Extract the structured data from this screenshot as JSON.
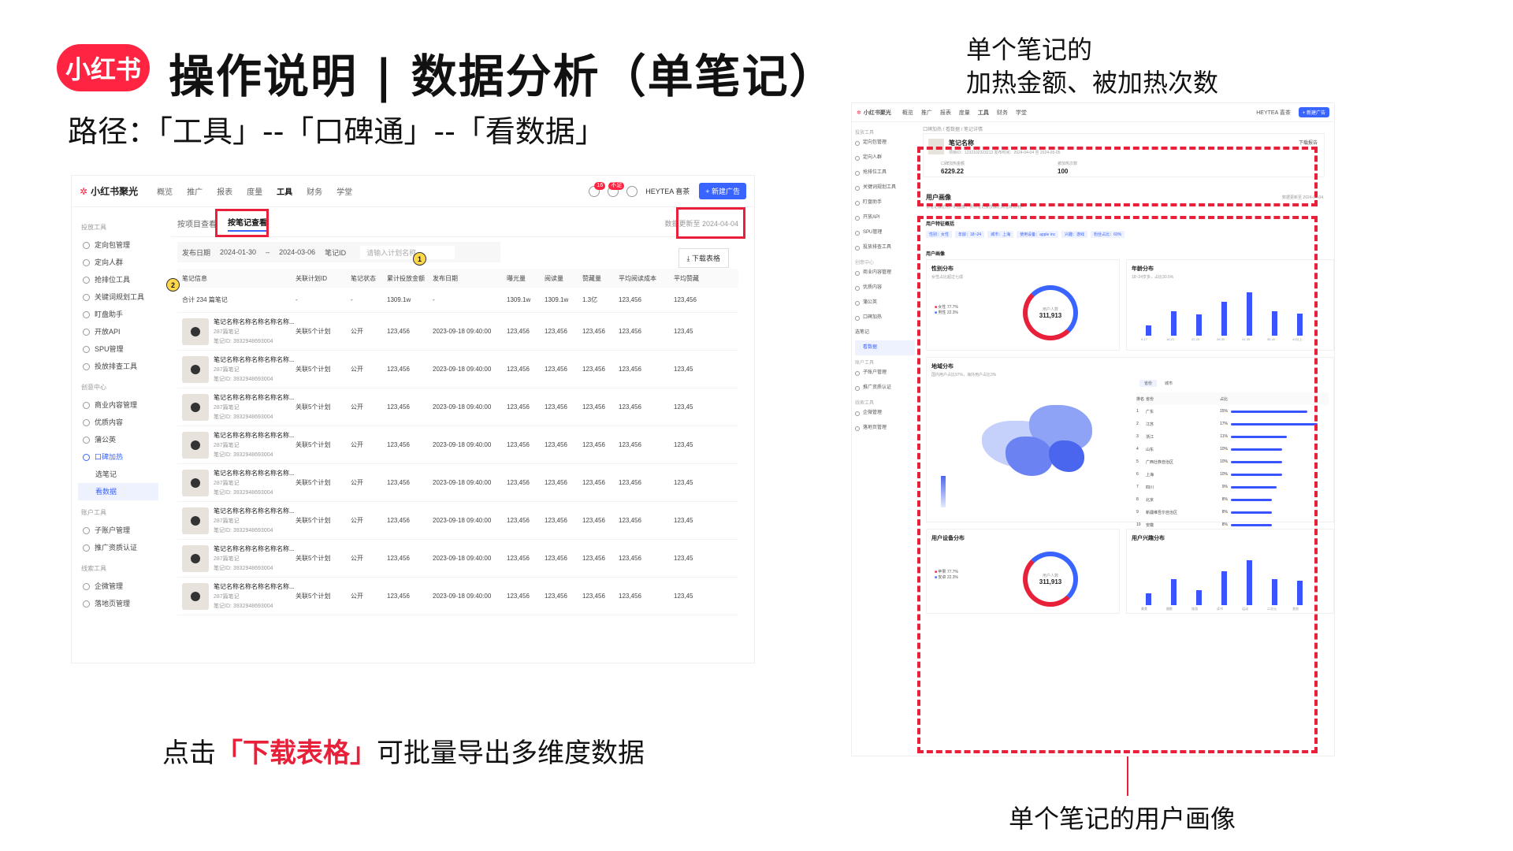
{
  "header": {
    "logo_text": "小红书",
    "title": "操作说明 | 数据分析（单笔记）",
    "path": "路径：「工具」--「口碑通」--「看数据」"
  },
  "caption": {
    "prefix": "点击",
    "highlight": "「下载表格」",
    "suffix": "可批量导出多维度数据"
  },
  "annotations": {
    "top_right_line1": "单个笔记的",
    "top_right_line2": "加热金额、被加热次数",
    "bottom_right": "单个笔记的用户画像"
  },
  "left_shot": {
    "app_name": "小红书聚光",
    "nav": [
      "概览",
      "推广",
      "报表",
      "度量",
      "工具",
      "财务",
      "学堂"
    ],
    "badges": [
      "16",
      "不足"
    ],
    "account": "HEYTEA 喜茶",
    "new_ad_button": "+ 新建广告",
    "sidebar": {
      "group1": "投放工具",
      "items1": [
        "定向包管理",
        "定向人群",
        "抢排位工具",
        "关键词规划工具",
        "盯盘助手",
        "开放API",
        "SPU管理",
        "投放排查工具"
      ],
      "group2": "创意中心",
      "items2": [
        "商业内容管理",
        "优质内容",
        "蒲公英",
        "口碑加热"
      ],
      "sub_items": [
        "选笔记",
        "看数据"
      ],
      "group3": "账户工具",
      "items3": [
        "子账户管理",
        "推广资质认证"
      ],
      "group4": "线索工具",
      "items4": [
        "企微管理",
        "落地页管理"
      ]
    },
    "tabs": [
      "按项目查看",
      "按笔记查看"
    ],
    "update_text": "数据更新至 2024-04-04",
    "filters": {
      "date_label": "发布日期",
      "date_from": "2024-01-30",
      "date_to": "2024-03-06",
      "select": "笔记ID",
      "search_placeholder": "请输入计划名称"
    },
    "download_button": "下载表格",
    "markers": [
      "1",
      "2"
    ],
    "columns": [
      "笔记信息",
      "关联计划ID",
      "笔记状态",
      "累计投放金额",
      "发布日期",
      "曝光量",
      "阅读量",
      "赞藏量",
      "平均阅读成本",
      "平均赞藏"
    ],
    "total_row": [
      "合计 234 篇笔记",
      "-",
      "-",
      "1309.1w",
      "-",
      "1309.1w",
      "1309.1w",
      "1.3亿",
      "123,456",
      "123,456"
    ],
    "row_template": {
      "title": "笔记名称名称名称名称名称...",
      "sub1": "287篇笔记",
      "sub2": "笔记ID: 3932948693004",
      "plan": "关联5个计划",
      "status": "公开",
      "amount": "123,456",
      "date": "2023-09-18 09:40:00",
      "expo": "123,456",
      "read": "123,456",
      "like": "123,456",
      "avg": "123,456",
      "avg2": "123,45"
    }
  },
  "right_shot": {
    "app_name": "小红书聚光",
    "breadcrumb": "口碑加热 / 看数据 / 笔记详情",
    "note_name": "笔记名称",
    "note_meta": "项目ID：1232102323213   发布时间：2024-04-04 至 2024-05-05",
    "download": "下载报告",
    "metric1_label": "口碑加热金额",
    "metric1_value": "6229.22",
    "metric2_label": "被加热次数",
    "metric2_value": "100",
    "portrait_title": "用户画像",
    "portrait_update": "数据更新至 2024-04-04",
    "portrait_desc": "该笔记触达用户的画像，供你笔记投放触达高潜目标用户",
    "feature_title": "用户特征概括",
    "feature_tags": [
      "性别：女性",
      "年龄：18~24",
      "城市：上海",
      "使用设备：apple inc",
      "兴趣：游戏",
      "粉丝占比：60%"
    ],
    "portrait_sub": "用户画像",
    "gender_title": "性别分布",
    "gender_desc": "女性占比超过七成",
    "gender_legend": [
      {
        "label": "女性",
        "pct": "77.7%"
      },
      {
        "label": "男性",
        "pct": "22.3%"
      }
    ],
    "donut_label": "用户人数",
    "donut_value": "311,913",
    "age_title": "年龄分布",
    "age_desc": "18~24岁多，占比30.5%",
    "age_categories": [
      "0-17",
      "18-21",
      "22-25",
      "26-30",
      "31-35",
      "36-40",
      "41以上"
    ],
    "age_values": [
      15,
      35,
      30,
      48,
      62,
      35,
      32
    ],
    "region_title": "地域分布",
    "region_desc": "国内用户占比97%，海外用户占比3%",
    "region_tabs": [
      "省份",
      "城市"
    ],
    "region_header": [
      "排名",
      "省份",
      "占比"
    ],
    "regions": [
      {
        "rank": "1",
        "name": "广东",
        "pct": "15%",
        "v": 15
      },
      {
        "rank": "2",
        "name": "江苏",
        "pct": "17%",
        "v": 17
      },
      {
        "rank": "3",
        "name": "浙江",
        "pct": "11%",
        "v": 11
      },
      {
        "rank": "4",
        "name": "山东",
        "pct": "10%",
        "v": 10
      },
      {
        "rank": "5",
        "name": "广西壮族自治区",
        "pct": "10%",
        "v": 10
      },
      {
        "rank": "6",
        "name": "上海",
        "pct": "10%",
        "v": 10
      },
      {
        "rank": "7",
        "name": "四川",
        "pct": "9%",
        "v": 9
      },
      {
        "rank": "8",
        "name": "北京",
        "pct": "8%",
        "v": 8
      },
      {
        "rank": "9",
        "name": "新疆维吾尔自治区",
        "pct": "8%",
        "v": 8
      },
      {
        "rank": "10",
        "name": "安徽",
        "pct": "8%",
        "v": 8
      }
    ],
    "device_title": "用户设备分布",
    "device_legend": [
      {
        "label": "苹果",
        "pct": "77.7%"
      },
      {
        "label": "安卓",
        "pct": "22.3%"
      }
    ],
    "interest_title": "用户兴趣分布",
    "interest_categories": [
      "美食",
      "摄影",
      "旅游",
      "读书",
      "运动",
      "二次元",
      "其他"
    ],
    "interest_values": [
      15,
      32,
      18,
      42,
      55,
      32,
      30
    ]
  },
  "colors": {
    "brand": "#ff2442",
    "highlight": "#e8203a",
    "accent": "#3a55ff"
  }
}
